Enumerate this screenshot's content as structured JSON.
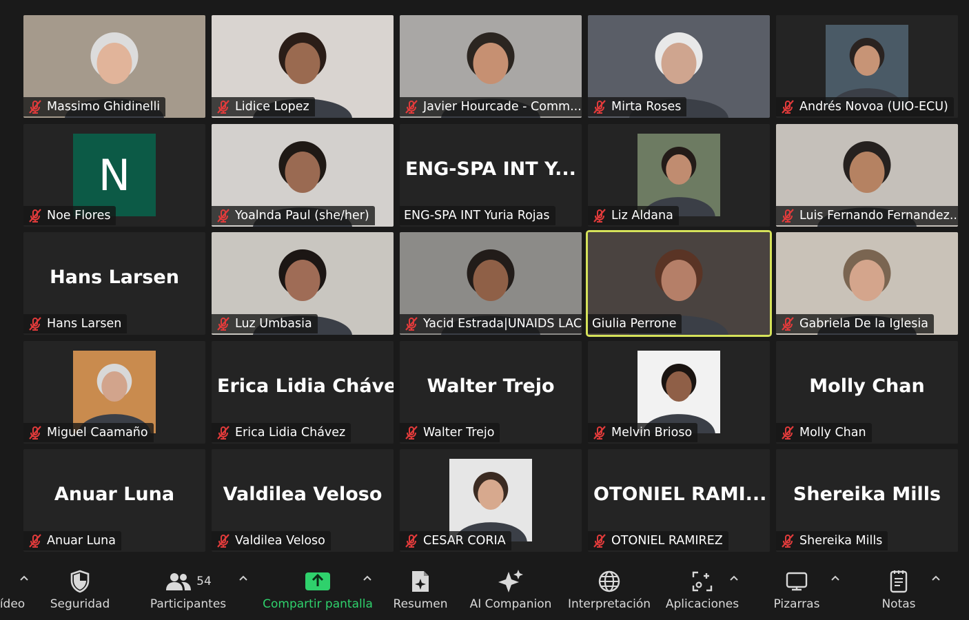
{
  "participants": [
    {
      "name": "Massimo Ghidinelli",
      "muted": true,
      "kind": "video",
      "bg": "#a59a8c",
      "skin": "#e1b49a",
      "hair": "#dcdcdc"
    },
    {
      "name": "Lidice Lopez",
      "muted": true,
      "kind": "video",
      "bg": "#d9d4d0",
      "skin": "#9a6a50",
      "hair": "#2a1d17"
    },
    {
      "name": "Javier Hourcade - Comm...",
      "muted": true,
      "kind": "video",
      "bg": "#a9a7a5",
      "skin": "#c69072",
      "hair": "#2b2520"
    },
    {
      "name": "Mirta Roses",
      "muted": true,
      "kind": "video",
      "bg": "#5a5e67",
      "skin": "#cfa58f",
      "hair": "#e8e8e8"
    },
    {
      "name": "Andrés Novoa (UIO-ECU)",
      "muted": true,
      "kind": "photo",
      "bg": "#4a5a66",
      "skin": "#c79476",
      "hair": "#2a2320"
    },
    {
      "name": "Noe Flores",
      "muted": true,
      "kind": "initial",
      "initial": "N"
    },
    {
      "name": "Yoalnda Paul (she/her)",
      "muted": true,
      "kind": "video",
      "bg": "#d3d0cd",
      "skin": "#9a6a52",
      "hair": "#1f1915"
    },
    {
      "name": "ENG-SPA INT Yuria Rojas",
      "muted": false,
      "kind": "name",
      "display": "ENG-SPA  INT  Y..."
    },
    {
      "name": "Liz Aldana",
      "muted": true,
      "kind": "photo",
      "bg": "#6d7b62",
      "skin": "#c08c70",
      "hair": "#231b18"
    },
    {
      "name": "Luis Fernando Fernandez...",
      "muted": true,
      "kind": "video",
      "bg": "#c5c0ba",
      "skin": "#b58262",
      "hair": "#26211f"
    },
    {
      "name": "Hans Larsen",
      "muted": true,
      "kind": "name",
      "display": "Hans Larsen"
    },
    {
      "name": "Luz Umbasia",
      "muted": true,
      "kind": "video",
      "bg": "#c9c6c0",
      "skin": "#9f6c56",
      "hair": "#1c1614"
    },
    {
      "name": "Yacid Estrada|UNAIDS LAC",
      "muted": true,
      "kind": "video",
      "bg": "#8c8b88",
      "skin": "#8f6047",
      "hair": "#221c19"
    },
    {
      "name": "Giulia Perrone",
      "muted": false,
      "kind": "video",
      "bg": "#4a4340",
      "skin": "#b57f68",
      "hair": "#5a3425",
      "active": true
    },
    {
      "name": "Gabriela De la Iglesia",
      "muted": true,
      "kind": "video",
      "bg": "#c9c2b8",
      "skin": "#d4a58c",
      "hair": "#7a6551"
    },
    {
      "name": "Miguel Caamaño",
      "muted": true,
      "kind": "photo",
      "bg": "#c98b4e",
      "skin": "#d2a48c",
      "hair": "#d8d8d8"
    },
    {
      "name": "Erica Lidia Chávez",
      "muted": true,
      "kind": "name",
      "display": "Erica Lidia Chávez"
    },
    {
      "name": "Walter Trejo",
      "muted": true,
      "kind": "name",
      "display": "Walter Trejo"
    },
    {
      "name": "Melvin Brioso",
      "muted": true,
      "kind": "photo",
      "bg": "#f2f2f2",
      "skin": "#8f5f47",
      "hair": "#1a1411"
    },
    {
      "name": "Molly Chan",
      "muted": true,
      "kind": "name",
      "display": "Molly Chan"
    },
    {
      "name": "Anuar Luna",
      "muted": true,
      "kind": "name",
      "display": "Anuar Luna"
    },
    {
      "name": "Valdilea Veloso",
      "muted": true,
      "kind": "name",
      "display": "Valdilea Veloso"
    },
    {
      "name": "CESAR CORIA",
      "muted": true,
      "kind": "photo",
      "bg": "#e6e6e6",
      "skin": "#d7a98e",
      "hair": "#3b2b22"
    },
    {
      "name": "OTONIEL RAMIREZ",
      "muted": true,
      "kind": "name",
      "display": "OTONIEL  RAMI..."
    },
    {
      "name": "Shereika Mills",
      "muted": true,
      "kind": "name",
      "display": "Shereika Mills"
    }
  ],
  "toolbar": {
    "video_label": "ídeo",
    "security_label": "Seguridad",
    "participants_label": "Participantes",
    "participants_count": "54",
    "share_label": "Compartir pantalla",
    "summary_label": "Resumen",
    "ai_label": "AI Companion",
    "interpretation_label": "Interpretación",
    "apps_label": "Aplicaciones",
    "whiteboards_label": "Pizarras",
    "notes_label": "Notas"
  },
  "colors": {
    "active_speaker_border": "#d6e35a",
    "share_green": "#2fd16c",
    "mute_red": "#e23b3b",
    "initial_bg": "#0c5a46"
  }
}
